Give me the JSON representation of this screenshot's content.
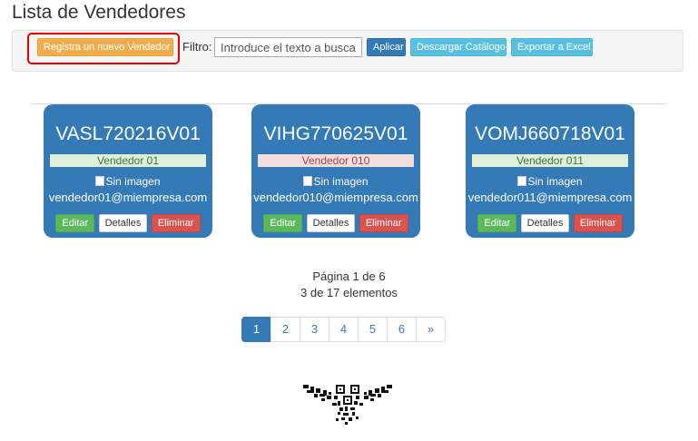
{
  "page": {
    "title": "Lista de Vendedores"
  },
  "toolbar": {
    "new_button": "Registra un nuevo Vendedor",
    "filter_label": "Filtro:",
    "filter_placeholder": "Introduce el texto a buscar:",
    "apply_button": "Aplicar",
    "download_button": "Descargar Catálogo",
    "export_button": "Exportar a Excel"
  },
  "cards": [
    {
      "rfc": "VASL720216V01",
      "name": "Vendedor 01",
      "image_alt": "Sin imagen",
      "email": "vendedor01@miempresa.com",
      "edit": "Editar",
      "details": "Detalles",
      "delete": "Eliminar"
    },
    {
      "rfc": "VIHG770625V01",
      "name": "Vendedor 010",
      "image_alt": "Sin imagen",
      "email": "vendedor010@miempresa.com",
      "edit": "Editar",
      "details": "Detalles",
      "delete": "Eliminar"
    },
    {
      "rfc": "VOMJ660718V01",
      "name": "Vendedor 011",
      "image_alt": "Sin imagen",
      "email": "vendedor011@miempresa.com",
      "edit": "Editar",
      "details": "Detalles",
      "delete": "Eliminar"
    }
  ],
  "paging": {
    "page_text": "Página 1 de 6",
    "count_text": "3 de 17 elementos",
    "pages": [
      "1",
      "2",
      "3",
      "4",
      "5",
      "6",
      "»"
    ],
    "active_page": "1"
  },
  "colors": {
    "card": "#337ab7",
    "highlight": "#e00000",
    "name_green_bg": "#dff0d8",
    "name_red_bg": "#f2dede"
  },
  "icons": {
    "logo": "qr-bird-logo-icon",
    "image": "broken-image-icon"
  }
}
